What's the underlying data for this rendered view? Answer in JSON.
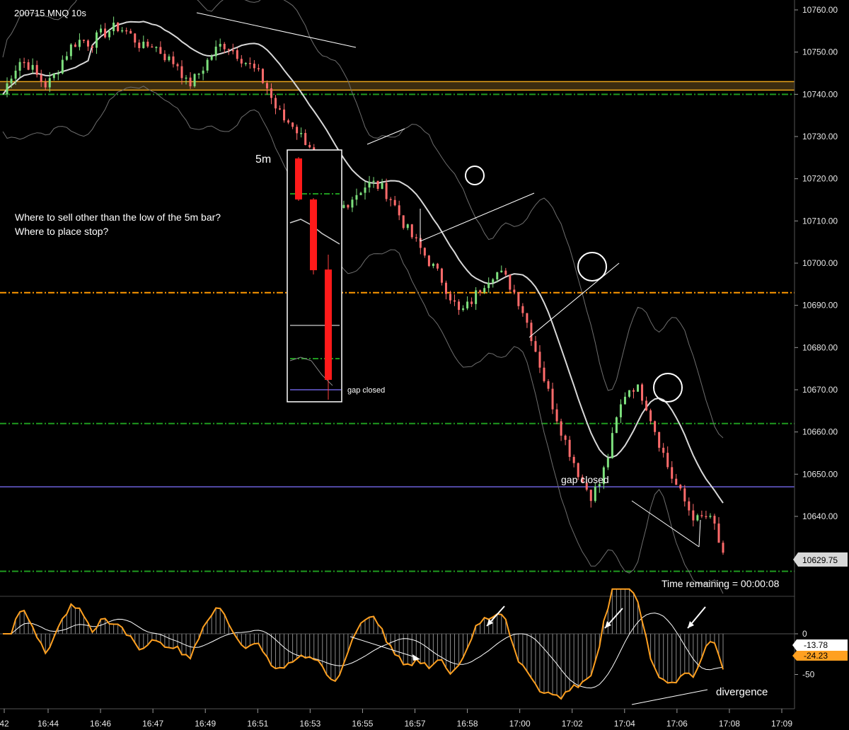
{
  "chart_data": {
    "type": "candlestick",
    "title": "200715 MNQ 10s",
    "price_axis": {
      "ylim": [
        10626,
        10762
      ],
      "ticks": [
        10760,
        10750,
        10740,
        10730,
        10720,
        10710,
        10700,
        10690,
        10680,
        10670,
        10660,
        10650,
        10640
      ],
      "tick_labels": [
        "10760.00",
        "10750.00",
        "10740.00",
        "10730.00",
        "10720.00",
        "10710.00",
        "10700.00",
        "10690.00",
        "10680.00",
        "10670.00",
        "10660.00",
        "10650.00",
        "10640.00"
      ],
      "last_price": "10629.75"
    },
    "time_axis": {
      "tick_labels": [
        "42",
        "16:44",
        "16:46",
        "16:47",
        "16:49",
        "16:51",
        "16:53",
        "16:55",
        "16:57",
        "16:58",
        "17:00",
        "17:02",
        "17:04",
        "17:06",
        "17:08",
        "17:09"
      ]
    },
    "horizontal_levels": [
      {
        "price": 10743,
        "color": "#e8a41c",
        "style": "solid"
      },
      {
        "price": 10741,
        "color": "#e8a41c",
        "style": "solid"
      },
      {
        "price": 10740,
        "color": "#1f9a1f",
        "style": "dash-dot"
      },
      {
        "price": 10693,
        "color": "#ff9900",
        "style": "dash-dot"
      },
      {
        "price": 10662,
        "color": "#1f9a1f",
        "style": "dash-dot"
      },
      {
        "price": 10647,
        "color": "#6a5fd8",
        "style": "solid"
      },
      {
        "price": 10627,
        "color": "#1f9a1f",
        "style": "dash-dot"
      }
    ],
    "close_path": [
      10740,
      10745,
      10748,
      10747,
      10744,
      10742,
      10745,
      10749,
      10752,
      10753,
      10752,
      10754,
      10755,
      10756,
      10755,
      10753,
      10751,
      10752,
      10750,
      10748,
      10747,
      10742,
      10744,
      10747,
      10750,
      10752,
      10751,
      10749,
      10747,
      10745,
      10742,
      10737,
      10734,
      10733,
      10730,
      10728,
      10722,
      10716,
      10712,
      10714,
      10716,
      10718,
      10719,
      10718,
      10716,
      10712,
      10708,
      10705,
      10702,
      10699,
      10696,
      10692,
      10688,
      10690,
      10693,
      10696,
      10698,
      10697,
      10694,
      10690,
      10684,
      10677,
      10670,
      10664,
      10658,
      10653,
      10648,
      10645,
      10648,
      10655,
      10664,
      10670,
      10671,
      10668,
      10662,
      10656,
      10650,
      10646,
      10642,
      10639,
      10640,
      10638,
      10630
    ],
    "annotations": {
      "inset_label": "5m",
      "question_1": "Where to sell other than the low of the 5m bar?",
      "question_2": "Where to place stop?",
      "gap_closed": "gap closed",
      "inset_gap_closed": "gap closed",
      "time_remaining": "Time remaining = 00:00:08",
      "divergence": "divergence"
    },
    "oscillator": {
      "ylim": [
        -80,
        60
      ],
      "ticks": [
        0,
        -50
      ],
      "tick_labels": [
        "0",
        "-50"
      ],
      "last_values": [
        "-13.78",
        "-24.23"
      ],
      "fast_color": "#ffa020",
      "slow_color": "#ffffff"
    }
  }
}
